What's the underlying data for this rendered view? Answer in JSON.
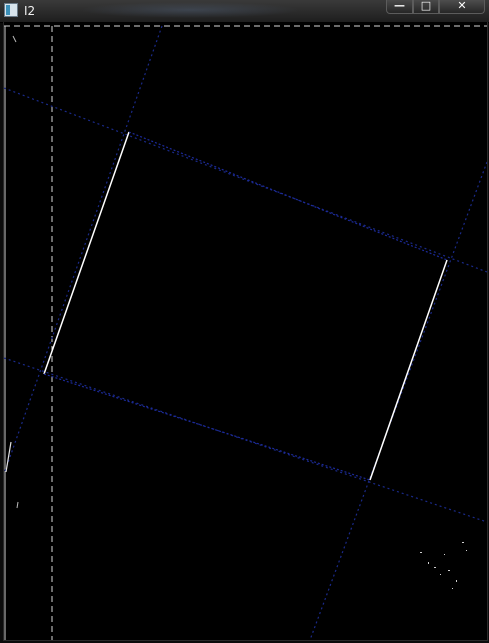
{
  "window": {
    "title": "I2",
    "minimize_glyph": "—",
    "maximize_glyph": "□",
    "close_glyph": "✕"
  },
  "canvas": {
    "background": "#000000",
    "line_colors": {
      "rectangle_edge": "#ffffff",
      "faint_line": "#0f1a5a",
      "guide_dashed": "#d8d8d8"
    }
  }
}
